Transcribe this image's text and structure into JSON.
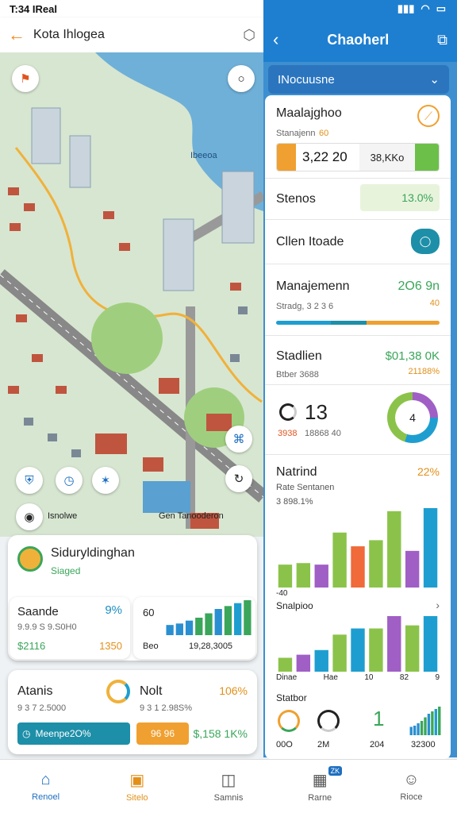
{
  "left_status": {
    "time": "T:34 IReal"
  },
  "left_header": {
    "title": "Kota Ihlogea"
  },
  "map": {
    "label_top": "Ibeeoa",
    "label_bottom": "Isnolwe",
    "label_bottom2": "Gen Tanooderon"
  },
  "left_card1": {
    "title": "Siduryldinghan",
    "subtitle": "Siaged",
    "stat1_label": "Saande",
    "stat1_pct": "9%",
    "stat1_sub": "9.9.9 S 9.S0H0",
    "stat1_val": "$2116",
    "stat1_val2": "1350",
    "mini_val": "60",
    "mini_x1": "Beo",
    "mini_x2": "19,28,3005"
  },
  "left_card2": {
    "label": "Atanis",
    "sub": "9 3 7 2.5000",
    "label2": "Nolt",
    "pct": "106%",
    "sub2": "9 3 1 2.98S%",
    "btn1": "Meenpe2O%",
    "btn2": "96 96",
    "val": "$,158 1K%"
  },
  "right_header": {
    "title": "Chaoherl"
  },
  "dropdown": {
    "label": "INocuusne"
  },
  "summary": {
    "title": "Maalajghoo",
    "subtitle": "Stanajenn",
    "subtitle_val": "60",
    "chip_value": "3,22 20",
    "chip_right": "38,KKo",
    "status_label": "Stenos",
    "status_value": "13.0%",
    "toggle_label": "Cllen Itoade"
  },
  "management": {
    "label": "Manajemenn",
    "value": "2O6 9n",
    "sub": "Stradg, 3 2 3 6",
    "sub_val": "40"
  },
  "station": {
    "label": "Stadlien",
    "value": "$01,38 0K",
    "sub": "Btber 3688",
    "sub_val": "21188%",
    "big": "13",
    "small1": "3938",
    "small2": "18868 40",
    "donut_center": "4"
  },
  "chart1": {
    "label": "Natrind",
    "pct": "22%",
    "sub1": "Rate Sentanen",
    "sub2": "3 898.1%",
    "axis_zero": "-40",
    "footer": "Snalpioo"
  },
  "chart2": {
    "x_labels": [
      "Dinae",
      "Hae",
      "10",
      "82",
      "9"
    ]
  },
  "bottom_row": {
    "label": "Statbor",
    "g1": "00O",
    "g2": "2M",
    "big": "1",
    "x3": "204",
    "x4": "32300"
  },
  "nav": [
    {
      "label": "Renoel",
      "icon": "home-icon"
    },
    {
      "label": "Sitelo",
      "icon": "chat-icon"
    },
    {
      "label": "Samnis",
      "icon": "message-icon"
    },
    {
      "label": "Rarne",
      "icon": "calendar-icon",
      "badge": "ZK"
    },
    {
      "label": "Rioce",
      "icon": "profile-icon"
    }
  ],
  "chart_data": [
    {
      "type": "bar",
      "series": [
        {
          "values": [
            30,
            32,
            30,
            72,
            54,
            62,
            100,
            48,
            104
          ]
        }
      ],
      "colors": [
        "#8bc34a",
        "#8bc34a",
        "#a05fc5",
        "#8bc34a",
        "#f06a3a",
        "#8bc34a",
        "#8bc34a",
        "#a05fc5",
        "#1e9ed0"
      ]
    },
    {
      "type": "bar",
      "series": [
        {
          "values": [
            18,
            22,
            28,
            48,
            56,
            56,
            72,
            60,
            72
          ]
        }
      ],
      "colors": [
        "#8bc34a",
        "#a05fc5",
        "#1e9ed0",
        "#8bc34a",
        "#1e9ed0",
        "#8bc34a",
        "#a05fc5",
        "#8bc34a",
        "#1e9ed0"
      ]
    },
    {
      "type": "bar",
      "series": [
        {
          "values": [
            14,
            16,
            20,
            24,
            30,
            36,
            40,
            44,
            48
          ]
        }
      ],
      "colors": [
        "#2a8fd0",
        "#2a8fd0",
        "#2a8fd0",
        "#3aa65a",
        "#3aa65a",
        "#2a8fd0",
        "#3aa65a",
        "#1e9ed0",
        "#3aa65a"
      ]
    }
  ]
}
